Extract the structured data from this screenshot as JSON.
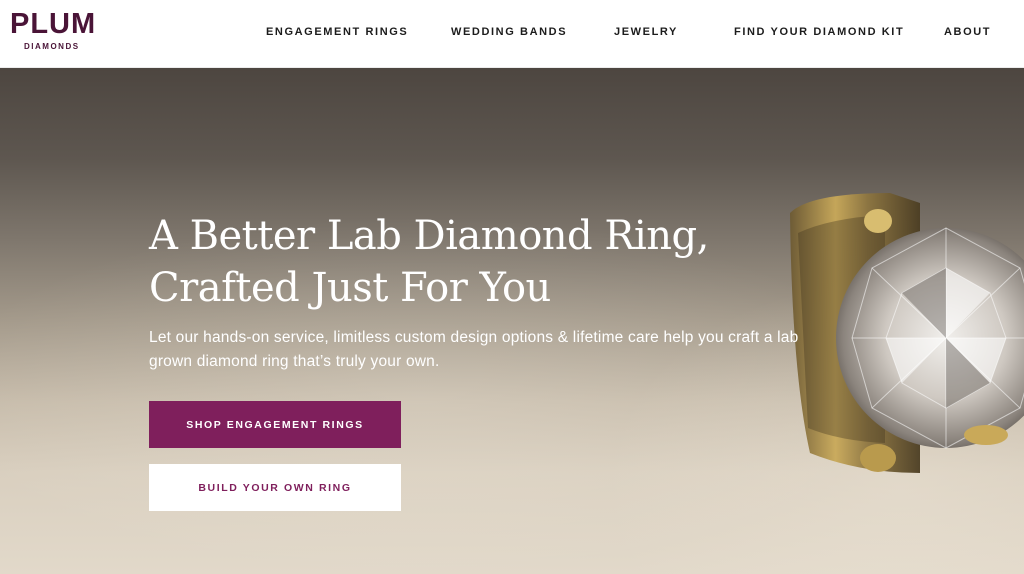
{
  "brand": {
    "name": "PLUM",
    "tagline": "DIAMONDS",
    "color": "#4a1437"
  },
  "nav": {
    "items": [
      {
        "label": "ENGAGEMENT RINGS"
      },
      {
        "label": "WEDDING BANDS"
      },
      {
        "label": "JEWELRY"
      },
      {
        "label": "FIND YOUR DIAMOND KIT"
      },
      {
        "label": "ABOUT"
      }
    ]
  },
  "hero": {
    "headline_line1": "A Better Lab Diamond Ring,",
    "headline_line2": "Crafted Just For You",
    "subtext": "Let our hands-on service, limitless custom design options & lifetime care help you craft a lab grown diamond ring that’s truly your own.",
    "image_icon": "diamond-ring-icon",
    "primary_cta": "SHOP ENGAGEMENT RINGS",
    "secondary_cta": "BUILD YOUR OWN RING"
  },
  "colors": {
    "accent": "#7f1f5c",
    "header_bg": "#ffffff",
    "text_on_hero": "#ffffff"
  }
}
